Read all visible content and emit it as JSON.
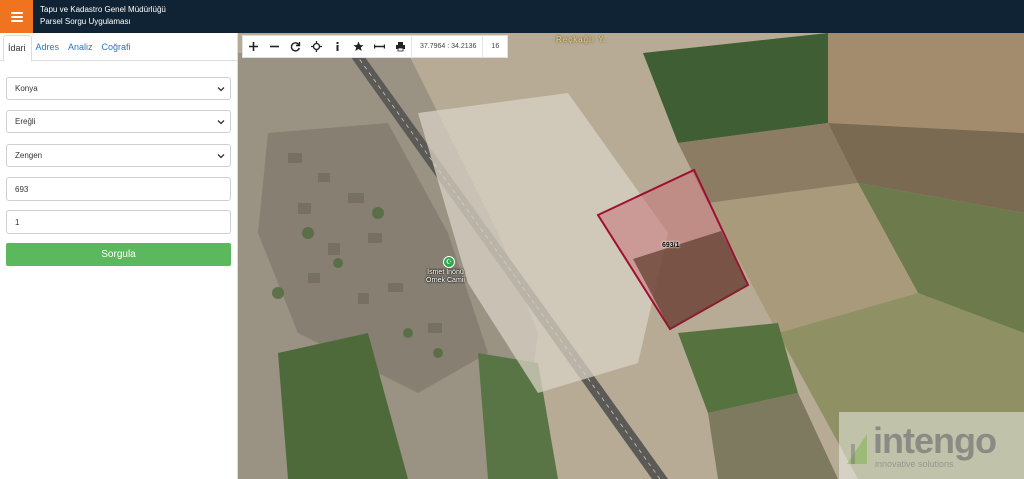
{
  "header": {
    "title_line1": "Tapu ve Kadastro Genel Müdürlüğü",
    "title_line2": "Parsel Sorgu Uygulaması",
    "menu_icon": "hamburger-icon",
    "colors": {
      "bar": "#0f2334",
      "menu": "#f0731f"
    }
  },
  "panel": {
    "tabs": [
      {
        "label": "İdari",
        "active": true
      },
      {
        "label": "Adres",
        "active": false
      },
      {
        "label": "Analiz",
        "active": false
      },
      {
        "label": "Coğrafi",
        "active": false
      }
    ],
    "province": "Konya",
    "district": "Ereğli",
    "neighborhood": "Zengen",
    "block_no": "693",
    "parcel_no": "1",
    "query_label": "Sorgula",
    "query_color": "#5cb85c"
  },
  "map": {
    "toolbar_icons": [
      "plus-icon",
      "minus-icon",
      "refresh-icon",
      "locate-icon",
      "info-icon",
      "star-icon",
      "measure-icon",
      "print-icon"
    ],
    "coordinates": "37.7964 : 34.2136",
    "zoom": "16",
    "place_label": "Reçkağlı Y.",
    "poi_label_line1": "İsmet İnönü",
    "poi_label_line2": "Örnek Camii",
    "parcel_label": "693/1",
    "parcel_color": "#b01e3c",
    "logo_text": "intengo",
    "logo_subtext": "innovative solutions"
  }
}
